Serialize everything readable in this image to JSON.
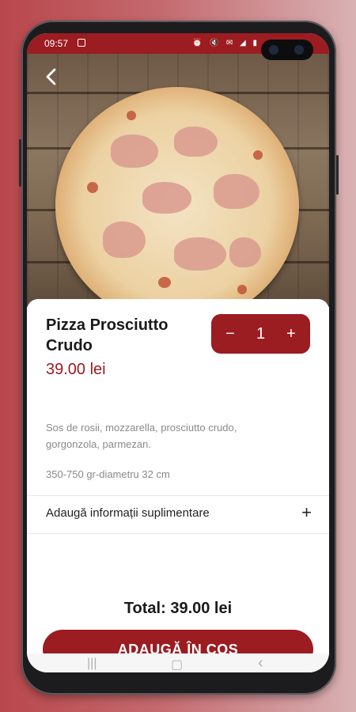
{
  "status_bar": {
    "time": "09:57",
    "right_icons": "⏰ 🔇 ✉ ◢ ▮"
  },
  "hero": {
    "image": "pizza-photo",
    "back_icon": "chevron-left-icon"
  },
  "product": {
    "title": "Pizza Prosciutto Crudo",
    "price": "39.00 lei",
    "description": "Sos de rosii, mozzarella, prosciutto crudo, gorgonzola, parmezan.",
    "weight": "350-750 gr-diametru 32 cm"
  },
  "quantity": {
    "minus": "−",
    "value": "1",
    "plus": "+"
  },
  "extra_info": {
    "label": "Adaugă informații suplimentare",
    "icon": "+"
  },
  "total": "Total: 39.00 lei",
  "cart_button": "ADAUGĂ ÎN COȘ",
  "nav": {
    "recent": "|||",
    "home": "▢",
    "back": "‹"
  },
  "colors": {
    "accent": "#9b1c21",
    "muted_text": "#8a8a8a"
  }
}
